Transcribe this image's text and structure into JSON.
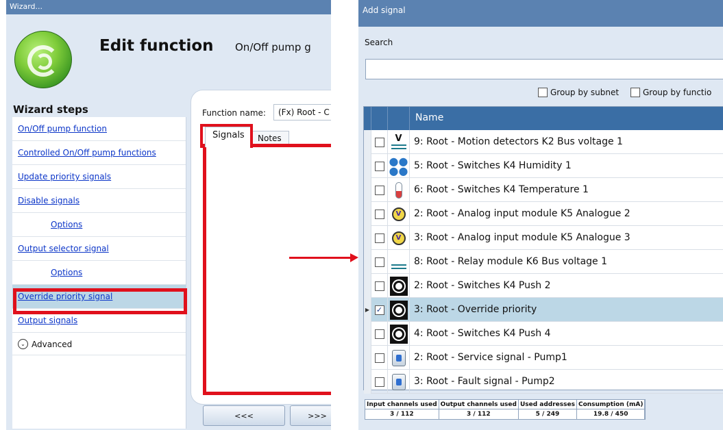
{
  "wizard": {
    "window_title": "Wizard...",
    "title": "Edit function",
    "subtitle": "On/Off pump g",
    "steps_heading": "Wizard steps",
    "steps": [
      {
        "label": "On/Off pump function",
        "indent": false,
        "active": false
      },
      {
        "label": "Controlled On/Off pump functions",
        "indent": false,
        "active": false
      },
      {
        "label": "Update priority signals",
        "indent": false,
        "active": false
      },
      {
        "label": "Disable signals",
        "indent": false,
        "active": false
      },
      {
        "label": "Options",
        "indent": true,
        "active": false
      },
      {
        "label": "Output selector signal",
        "indent": false,
        "active": false
      },
      {
        "label": "Options",
        "indent": true,
        "active": false
      },
      {
        "label": "Override priority signal",
        "indent": false,
        "active": true
      },
      {
        "label": "Output signals",
        "indent": false,
        "active": false
      }
    ],
    "advanced_label": "Advanced",
    "function_name_label": "Function name:",
    "function_name_value": "(Fx) Root - C",
    "tabs": [
      "Signals",
      "Notes"
    ],
    "prev_button": "<<<",
    "next_button": ">>>"
  },
  "add_signal": {
    "window_title": "Add signal",
    "search_label": "Search",
    "search_value": "",
    "group_by_subnet": "Group by subnet",
    "group_by_function": "Group by functio",
    "column_name": "Name",
    "rows": [
      {
        "icon": "bus-voltage-icon",
        "name": "9: Root - Motion detectors K2 Bus voltage 1",
        "checked": false,
        "selected": false
      },
      {
        "icon": "humidity-icon",
        "name": "5: Root - Switches K4 Humidity 1",
        "checked": false,
        "selected": false
      },
      {
        "icon": "temperature-icon",
        "name": "6: Root - Switches K4 Temperature 1",
        "checked": false,
        "selected": false
      },
      {
        "icon": "analogue-icon",
        "name": "2: Root - Analog input module K5 Analogue 2",
        "checked": false,
        "selected": false
      },
      {
        "icon": "analogue-icon",
        "name": "3: Root - Analog input module K5 Analogue 3",
        "checked": false,
        "selected": false
      },
      {
        "icon": "bus-voltage-icon",
        "name": "8: Root - Relay module K6 Bus voltage 1",
        "checked": false,
        "selected": false
      },
      {
        "icon": "push-button-icon",
        "name": "2: Root - Switches K4 Push 2",
        "checked": false,
        "selected": false
      },
      {
        "icon": "push-button-icon",
        "name": "3: Root - Override priority",
        "checked": true,
        "selected": true
      },
      {
        "icon": "push-button-icon",
        "name": "4: Root - Switches K4 Push 4",
        "checked": false,
        "selected": false
      },
      {
        "icon": "service-signal-icon",
        "name": "2: Root - Service signal - Pump1",
        "checked": false,
        "selected": false
      },
      {
        "icon": "service-signal-icon",
        "name": "3: Root - Fault signal - Pump2",
        "checked": false,
        "selected": false
      }
    ],
    "stats": [
      {
        "label": "Input channels used",
        "value": "3 / 112"
      },
      {
        "label": "Output channels used",
        "value": "3 / 112"
      },
      {
        "label": "Used addresses",
        "value": "5 / 249"
      },
      {
        "label": "Consumption (mA)",
        "value": "19.8 / 450"
      }
    ]
  },
  "colors": {
    "titlebar": "#5b82b1",
    "grid_header": "#3a6ea5",
    "selection": "#bcd7e6",
    "highlight_red": "#e0101c",
    "link_blue": "#0b35c8"
  }
}
